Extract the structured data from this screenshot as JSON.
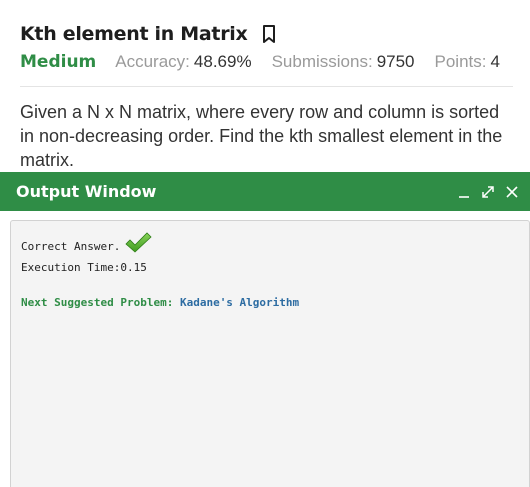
{
  "problem": {
    "title": "Kth element in Matrix",
    "difficulty": "Medium",
    "accuracy_label": "Accuracy:",
    "accuracy_value": "48.69%",
    "submissions_label": "Submissions:",
    "submissions_value": "9750",
    "points_label": "Points:",
    "points_value": "4",
    "description": "Given a N x N matrix, where every row and column is sorted in non-decreasing order. Find the kth smallest element in the matrix."
  },
  "output_window": {
    "title": "Output Window",
    "controls": [
      "minimize-icon",
      "expand-icon",
      "close-icon"
    ],
    "correct_text": "Correct Answer.",
    "execution_time": "Execution Time:0.15",
    "next_label": "Next Suggested Problem:",
    "next_link": "Kadane's Algorithm"
  },
  "colors": {
    "brand_green": "#2f8d46",
    "link_blue": "#2d6ca2",
    "check_green": "#5cb833"
  }
}
